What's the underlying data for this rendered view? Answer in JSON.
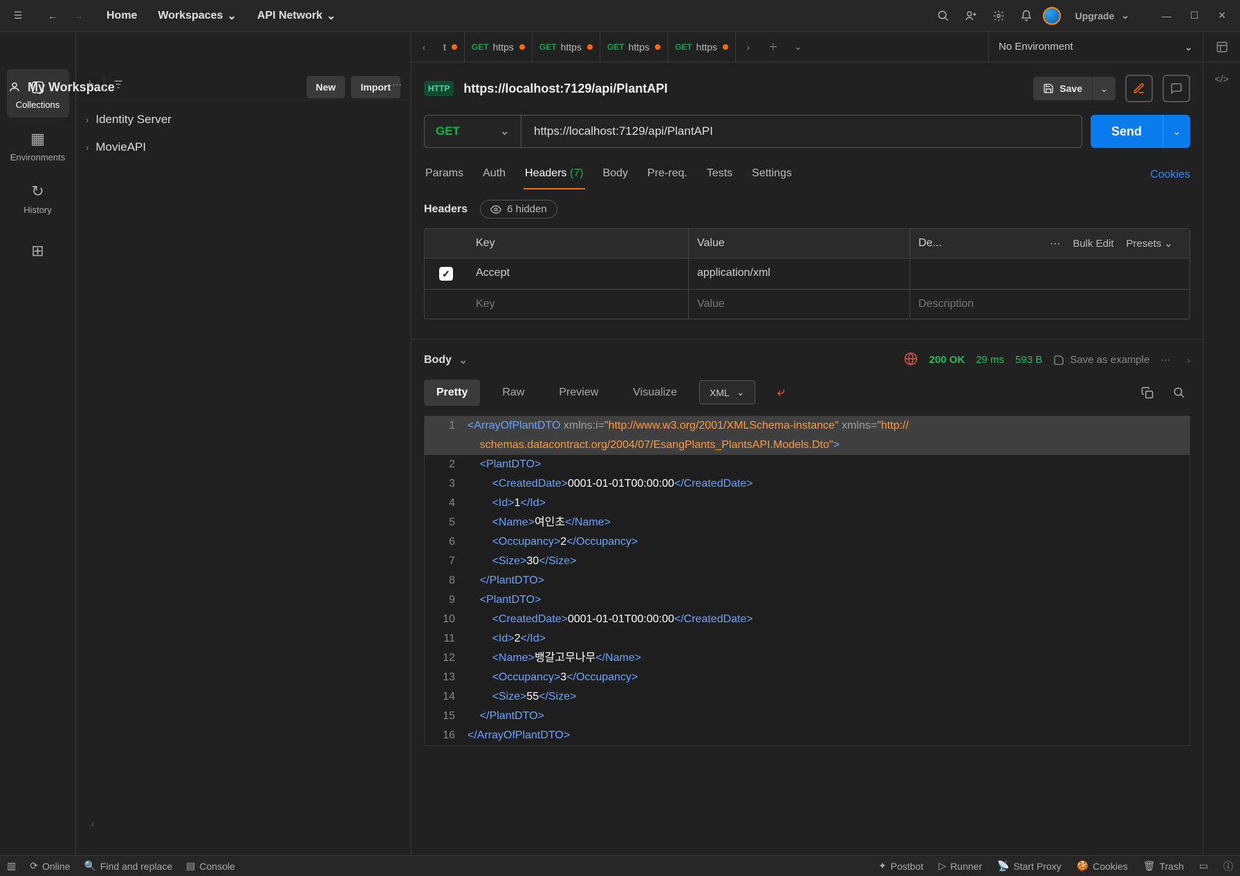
{
  "topbar": {
    "home": "Home",
    "workspaces": "Workspaces",
    "api_network": "API Network",
    "upgrade": "Upgrade"
  },
  "workspace": {
    "name": "My Workspace",
    "new_btn": "New",
    "import_btn": "Import"
  },
  "rail": {
    "collections": "Collections",
    "environments": "Environments",
    "history": "History"
  },
  "tree": {
    "items": [
      "Identity Server",
      "MovieAPI"
    ]
  },
  "tabs": {
    "items": [
      {
        "method": "",
        "label": "t"
      },
      {
        "method": "GET",
        "label": "https"
      },
      {
        "method": "GET",
        "label": "https"
      },
      {
        "method": "GET",
        "label": "https"
      },
      {
        "method": "GET",
        "label": "https"
      }
    ],
    "no_env": "No Environment"
  },
  "request": {
    "title": "https://localhost:7129/api/PlantAPI",
    "save": "Save",
    "method": "GET",
    "url": "https://localhost:7129/api/PlantAPI",
    "send": "Send",
    "tabs": {
      "params": "Params",
      "auth": "Auth",
      "headers": "Headers",
      "headers_count": "(7)",
      "body": "Body",
      "prereq": "Pre-req.",
      "tests": "Tests",
      "settings": "Settings",
      "cookies": "Cookies"
    }
  },
  "headers_section": {
    "title": "Headers",
    "hidden": "6 hidden",
    "col_key": "Key",
    "col_val": "Value",
    "col_desc": "De...",
    "bulk": "Bulk Edit",
    "presets": "Presets",
    "row_key": "Accept",
    "row_val": "application/xml",
    "ph_key": "Key",
    "ph_val": "Value",
    "ph_desc": "Description"
  },
  "response": {
    "body": "Body",
    "status": "200 OK",
    "time": "29 ms",
    "size": "593 B",
    "save_ex": "Save as example",
    "tabs": {
      "pretty": "Pretty",
      "raw": "Raw",
      "preview": "Preview",
      "visualize": "Visualize",
      "format": "XML"
    }
  },
  "xml_lines": {
    "l1a": "<ArrayOfPlantDTO",
    "l1attr1": " xmlns:i=",
    "l1s1": "\"http://www.w3.org/2001/XMLSchema-instance\"",
    "l1attr2": " xmlns=",
    "l1s2": "\"http://",
    "l1cont": "schemas.datacontract.org/2004/07/EsangPlants_PlantsAPI.Models.Dto\"",
    "l2": "<PlantDTO>",
    "l3o": "<CreatedDate>",
    "l3v": "0001-01-01T00:00:00",
    "l3c": "</CreatedDate>",
    "l4o": "<Id>",
    "l4v": "1",
    "l4c": "</Id>",
    "l5o": "<Name>",
    "l5v": "여인초",
    "l5c": "</Name>",
    "l6o": "<Occupancy>",
    "l6v": "2",
    "l6c": "</Occupancy>",
    "l7o": "<Size>",
    "l7v": "30",
    "l7c": "</Size>",
    "l8": "</PlantDTO>",
    "l9": "<PlantDTO>",
    "l10o": "<CreatedDate>",
    "l10v": "0001-01-01T00:00:00",
    "l10c": "</CreatedDate>",
    "l11o": "<Id>",
    "l11v": "2",
    "l11c": "</Id>",
    "l12o": "<Name>",
    "l12v": "뱅갈고무나무",
    "l12c": "</Name>",
    "l13o": "<Occupancy>",
    "l13v": "3",
    "l13c": "</Occupancy>",
    "l14o": "<Size>",
    "l14v": "55",
    "l14c": "</Size>",
    "l15": "</PlantDTO>",
    "l16": "</ArrayOfPlantDTO>"
  },
  "statusbar": {
    "online": "Online",
    "find": "Find and replace",
    "console": "Console",
    "postbot": "Postbot",
    "runner": "Runner",
    "proxy": "Start Proxy",
    "cookies": "Cookies",
    "trash": "Trash"
  }
}
